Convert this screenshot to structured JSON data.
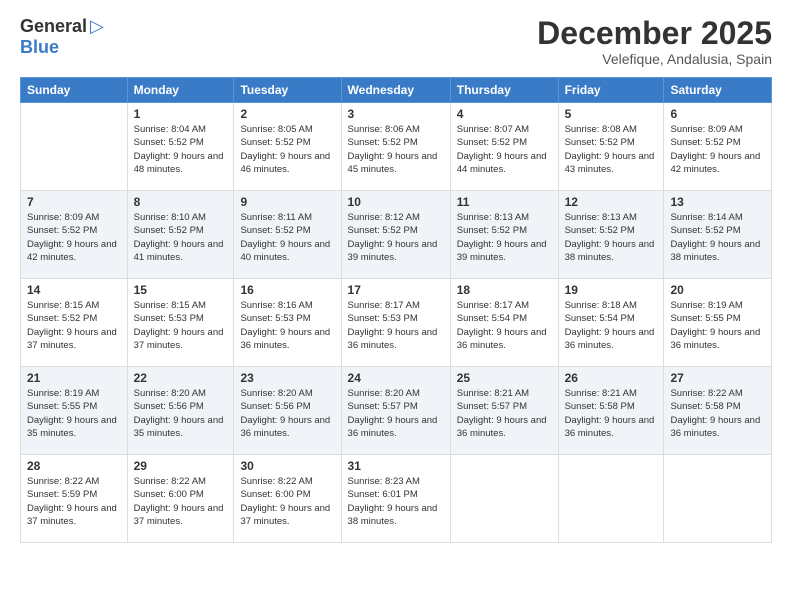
{
  "header": {
    "logo_general": "General",
    "logo_blue": "Blue",
    "month_title": "December 2025",
    "location": "Velefique, Andalusia, Spain"
  },
  "weekdays": [
    "Sunday",
    "Monday",
    "Tuesday",
    "Wednesday",
    "Thursday",
    "Friday",
    "Saturday"
  ],
  "weeks": [
    [
      {
        "day": "",
        "sunrise": "",
        "sunset": "",
        "daylight": ""
      },
      {
        "day": "1",
        "sunrise": "Sunrise: 8:04 AM",
        "sunset": "Sunset: 5:52 PM",
        "daylight": "Daylight: 9 hours and 48 minutes."
      },
      {
        "day": "2",
        "sunrise": "Sunrise: 8:05 AM",
        "sunset": "Sunset: 5:52 PM",
        "daylight": "Daylight: 9 hours and 46 minutes."
      },
      {
        "day": "3",
        "sunrise": "Sunrise: 8:06 AM",
        "sunset": "Sunset: 5:52 PM",
        "daylight": "Daylight: 9 hours and 45 minutes."
      },
      {
        "day": "4",
        "sunrise": "Sunrise: 8:07 AM",
        "sunset": "Sunset: 5:52 PM",
        "daylight": "Daylight: 9 hours and 44 minutes."
      },
      {
        "day": "5",
        "sunrise": "Sunrise: 8:08 AM",
        "sunset": "Sunset: 5:52 PM",
        "daylight": "Daylight: 9 hours and 43 minutes."
      },
      {
        "day": "6",
        "sunrise": "Sunrise: 8:09 AM",
        "sunset": "Sunset: 5:52 PM",
        "daylight": "Daylight: 9 hours and 42 minutes."
      }
    ],
    [
      {
        "day": "7",
        "sunrise": "Sunrise: 8:09 AM",
        "sunset": "Sunset: 5:52 PM",
        "daylight": "Daylight: 9 hours and 42 minutes."
      },
      {
        "day": "8",
        "sunrise": "Sunrise: 8:10 AM",
        "sunset": "Sunset: 5:52 PM",
        "daylight": "Daylight: 9 hours and 41 minutes."
      },
      {
        "day": "9",
        "sunrise": "Sunrise: 8:11 AM",
        "sunset": "Sunset: 5:52 PM",
        "daylight": "Daylight: 9 hours and 40 minutes."
      },
      {
        "day": "10",
        "sunrise": "Sunrise: 8:12 AM",
        "sunset": "Sunset: 5:52 PM",
        "daylight": "Daylight: 9 hours and 39 minutes."
      },
      {
        "day": "11",
        "sunrise": "Sunrise: 8:13 AM",
        "sunset": "Sunset: 5:52 PM",
        "daylight": "Daylight: 9 hours and 39 minutes."
      },
      {
        "day": "12",
        "sunrise": "Sunrise: 8:13 AM",
        "sunset": "Sunset: 5:52 PM",
        "daylight": "Daylight: 9 hours and 38 minutes."
      },
      {
        "day": "13",
        "sunrise": "Sunrise: 8:14 AM",
        "sunset": "Sunset: 5:52 PM",
        "daylight": "Daylight: 9 hours and 38 minutes."
      }
    ],
    [
      {
        "day": "14",
        "sunrise": "Sunrise: 8:15 AM",
        "sunset": "Sunset: 5:52 PM",
        "daylight": "Daylight: 9 hours and 37 minutes."
      },
      {
        "day": "15",
        "sunrise": "Sunrise: 8:15 AM",
        "sunset": "Sunset: 5:53 PM",
        "daylight": "Daylight: 9 hours and 37 minutes."
      },
      {
        "day": "16",
        "sunrise": "Sunrise: 8:16 AM",
        "sunset": "Sunset: 5:53 PM",
        "daylight": "Daylight: 9 hours and 36 minutes."
      },
      {
        "day": "17",
        "sunrise": "Sunrise: 8:17 AM",
        "sunset": "Sunset: 5:53 PM",
        "daylight": "Daylight: 9 hours and 36 minutes."
      },
      {
        "day": "18",
        "sunrise": "Sunrise: 8:17 AM",
        "sunset": "Sunset: 5:54 PM",
        "daylight": "Daylight: 9 hours and 36 minutes."
      },
      {
        "day": "19",
        "sunrise": "Sunrise: 8:18 AM",
        "sunset": "Sunset: 5:54 PM",
        "daylight": "Daylight: 9 hours and 36 minutes."
      },
      {
        "day": "20",
        "sunrise": "Sunrise: 8:19 AM",
        "sunset": "Sunset: 5:55 PM",
        "daylight": "Daylight: 9 hours and 36 minutes."
      }
    ],
    [
      {
        "day": "21",
        "sunrise": "Sunrise: 8:19 AM",
        "sunset": "Sunset: 5:55 PM",
        "daylight": "Daylight: 9 hours and 35 minutes."
      },
      {
        "day": "22",
        "sunrise": "Sunrise: 8:20 AM",
        "sunset": "Sunset: 5:56 PM",
        "daylight": "Daylight: 9 hours and 35 minutes."
      },
      {
        "day": "23",
        "sunrise": "Sunrise: 8:20 AM",
        "sunset": "Sunset: 5:56 PM",
        "daylight": "Daylight: 9 hours and 36 minutes."
      },
      {
        "day": "24",
        "sunrise": "Sunrise: 8:20 AM",
        "sunset": "Sunset: 5:57 PM",
        "daylight": "Daylight: 9 hours and 36 minutes."
      },
      {
        "day": "25",
        "sunrise": "Sunrise: 8:21 AM",
        "sunset": "Sunset: 5:57 PM",
        "daylight": "Daylight: 9 hours and 36 minutes."
      },
      {
        "day": "26",
        "sunrise": "Sunrise: 8:21 AM",
        "sunset": "Sunset: 5:58 PM",
        "daylight": "Daylight: 9 hours and 36 minutes."
      },
      {
        "day": "27",
        "sunrise": "Sunrise: 8:22 AM",
        "sunset": "Sunset: 5:58 PM",
        "daylight": "Daylight: 9 hours and 36 minutes."
      }
    ],
    [
      {
        "day": "28",
        "sunrise": "Sunrise: 8:22 AM",
        "sunset": "Sunset: 5:59 PM",
        "daylight": "Daylight: 9 hours and 37 minutes."
      },
      {
        "day": "29",
        "sunrise": "Sunrise: 8:22 AM",
        "sunset": "Sunset: 6:00 PM",
        "daylight": "Daylight: 9 hours and 37 minutes."
      },
      {
        "day": "30",
        "sunrise": "Sunrise: 8:22 AM",
        "sunset": "Sunset: 6:00 PM",
        "daylight": "Daylight: 9 hours and 37 minutes."
      },
      {
        "day": "31",
        "sunrise": "Sunrise: 8:23 AM",
        "sunset": "Sunset: 6:01 PM",
        "daylight": "Daylight: 9 hours and 38 minutes."
      },
      {
        "day": "",
        "sunrise": "",
        "sunset": "",
        "daylight": ""
      },
      {
        "day": "",
        "sunrise": "",
        "sunset": "",
        "daylight": ""
      },
      {
        "day": "",
        "sunrise": "",
        "sunset": "",
        "daylight": ""
      }
    ]
  ]
}
